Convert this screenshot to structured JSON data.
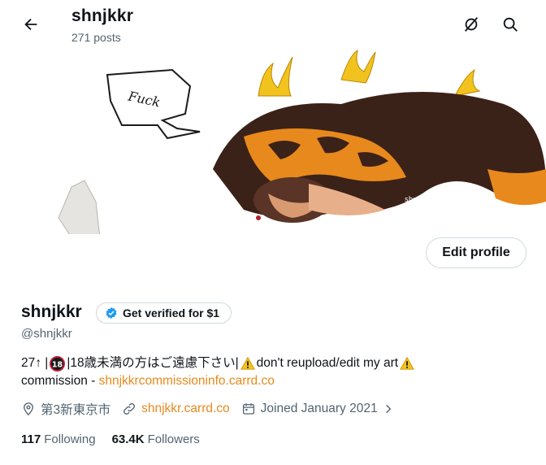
{
  "header": {
    "name": "shnjkkr",
    "posts_count": "271 posts"
  },
  "banner": {
    "speech_text": "Fuck",
    "signature": "shnjkkr"
  },
  "actions": {
    "edit_profile_label": "Edit profile"
  },
  "profile": {
    "display_name": "shnjkkr",
    "verify_label": "Get verified for $1",
    "handle": "@shnjkkr",
    "bio": {
      "line1_a": "27↑ |",
      "badge_18": "18",
      "line1_b": "|18歳未満の方はご遠慮下さい|",
      "line1_c": "don't reupload/edit my art",
      "line2_a": "commission - ",
      "line2_link": "shnjkkrcommissioninfo.carrd.co"
    },
    "location": "第3新東京市",
    "website": "shnjkkr.carrd.co",
    "joined": "Joined January 2021"
  },
  "stats": {
    "following_count": "117",
    "following_label": "Following",
    "followers_count": "63.4K",
    "followers_label": "Followers"
  },
  "colors": {
    "link": "#e8891d",
    "verified_blue": "#1d9bf0",
    "muted": "#536471"
  },
  "icons": [
    "back-arrow-icon",
    "no-location-icon",
    "search-icon",
    "verified-badge-icon",
    "location-pin-icon",
    "link-icon",
    "calendar-icon",
    "chevron-right-icon",
    "warning-icon",
    "age-18-badge-icon"
  ]
}
